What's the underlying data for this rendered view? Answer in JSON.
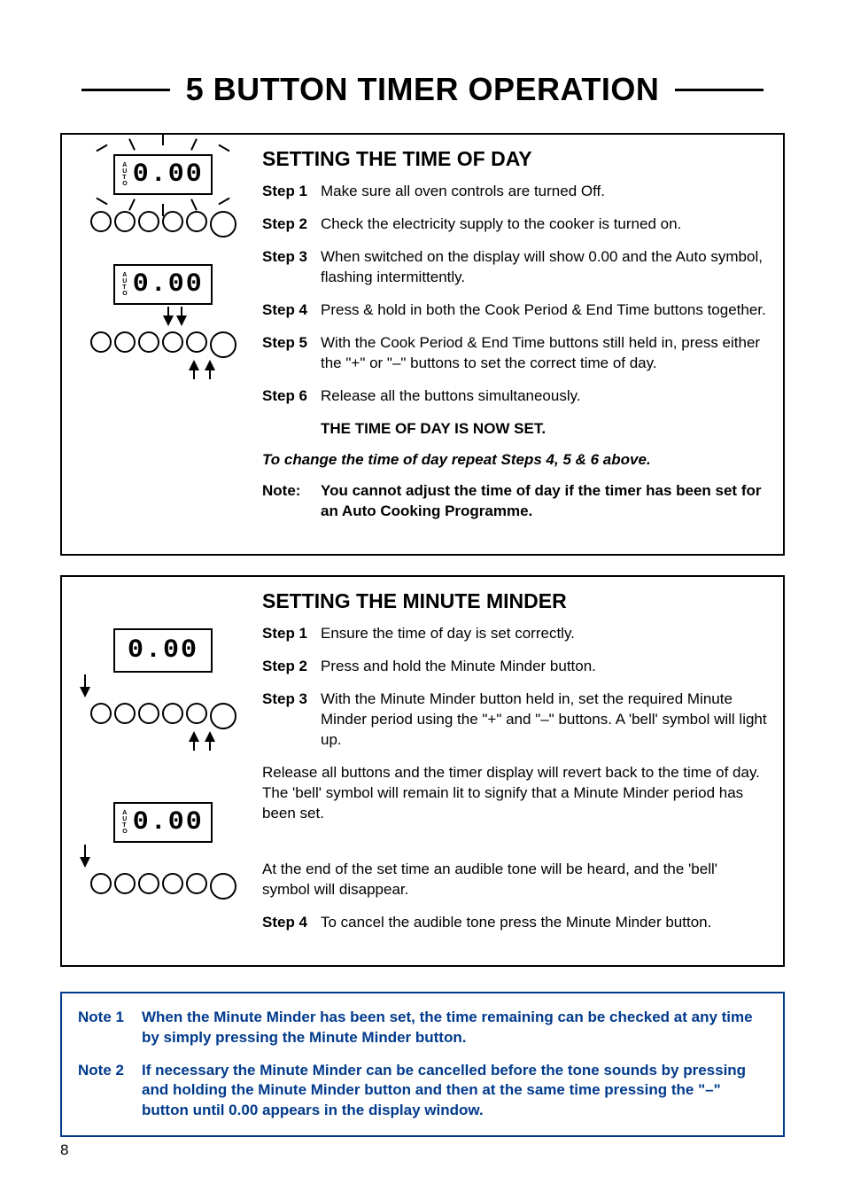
{
  "page_number": "8",
  "title": "5 BUTTON TIMER OPERATION",
  "lcd_value": "0.00",
  "auto_letters": [
    "A",
    "U",
    "T",
    "O"
  ],
  "section1": {
    "heading": "SETTING THE TIME OF DAY",
    "steps": [
      {
        "label": "Step 1",
        "text": "Make sure all oven controls are turned Off."
      },
      {
        "label": "Step 2",
        "text": "Check the electricity supply to the cooker is turned on."
      },
      {
        "label": "Step 3",
        "text": "When switched on the display will show 0.00 and the Auto symbol, flashing intermittently."
      },
      {
        "label": "Step 4",
        "text": "Press & hold in both the Cook Period & End Time buttons together."
      },
      {
        "label": "Step 5",
        "text": "With the Cook Period & End Time buttons still held in, press either the \"+\" or \"–\" buttons to set the correct time of day."
      },
      {
        "label": "Step 6",
        "text": "Release all the buttons simultaneously."
      }
    ],
    "confirmation": "THE TIME OF DAY IS NOW SET.",
    "repeat": "To change the time of day repeat Steps 4, 5 & 6 above.",
    "note_label": "Note:",
    "note_text": "You cannot adjust the time of day if the timer has been set for an Auto Cooking Programme."
  },
  "section2": {
    "heading": "SETTING THE MINUTE MINDER",
    "steps_a": [
      {
        "label": "Step 1",
        "text": "Ensure the time of day is set correctly."
      },
      {
        "label": "Step 2",
        "text": "Press and hold the  Minute Minder button."
      },
      {
        "label": "Step 3",
        "text": "With the Minute Minder button held in, set the required Minute Minder period using the \"+\" and \"–\" buttons. A 'bell' symbol will light up."
      }
    ],
    "para1": "Release all buttons and the timer display will revert back to the time of day. The 'bell' symbol will remain lit to signify that a Minute Minder period has been set.",
    "para2": "At the end of the set time an audible tone will be heard, and the 'bell' symbol will disappear.",
    "step4": {
      "label": "Step 4",
      "text": "To cancel the audible tone press the Minute Minder button."
    }
  },
  "notes": [
    {
      "label": "Note 1",
      "text": "When the Minute Minder has been set, the time remaining can be checked at any time by simply pressing the Minute Minder button."
    },
    {
      "label": "Note 2",
      "text": "If necessary the Minute Minder can be cancelled before the tone sounds by pressing and holding the Minute Minder button and then at the same time pressing the \"–\" button until 0.00 appears in the display window."
    }
  ]
}
